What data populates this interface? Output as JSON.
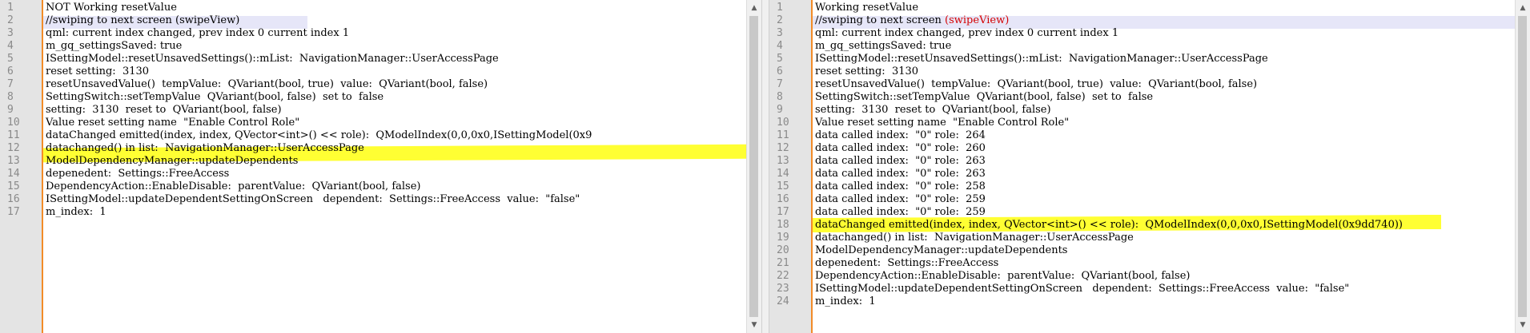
{
  "left_editor": {
    "lines": [
      {
        "n": "1",
        "text": "NOT Working resetValue"
      },
      {
        "n": "2",
        "text": "//swiping to next screen (swipeView)"
      },
      {
        "n": "3",
        "text": "qml: current index changed, prev index 0 current index 1"
      },
      {
        "n": "4",
        "text": "m_gq_settingsSaved: true"
      },
      {
        "n": "5",
        "text": "ISettingModel::resetUnsavedSettings()::mList:  NavigationManager::UserAccessPage"
      },
      {
        "n": "6",
        "text": "reset setting:  3130"
      },
      {
        "n": "7",
        "text": "resetUnsavedValue()  tempValue:  QVariant(bool, true)  value:  QVariant(bool, false)"
      },
      {
        "n": "8",
        "text": "SettingSwitch::setTempValue  QVariant(bool, false)  set to  false"
      },
      {
        "n": "9",
        "text": "setting:  3130  reset to  QVariant(bool, false)"
      },
      {
        "n": "10",
        "text": "Value reset setting name  \"Enable Control Role\""
      },
      {
        "n": "11",
        "text": "dataChanged emitted(index, index, QVector<int>() << role):  QModelIndex(0,0,0x0,ISettingModel(0x9"
      },
      {
        "n": "12",
        "text": "datachanged() in list:  NavigationManager::UserAccessPage"
      },
      {
        "n": "13",
        "text": "ModelDependencyManager::updateDependents"
      },
      {
        "n": "14",
        "text": "depenedent:  Settings::FreeAccess"
      },
      {
        "n": "15",
        "text": "DependencyAction::EnableDisable:  parentValue:  QVariant(bool, false)"
      },
      {
        "n": "16",
        "text": "ISettingModel::updateDependentSettingOnScreen   dependent:  Settings::FreeAccess  value:  \"false\""
      },
      {
        "n": "17",
        "text": "m_index:  1"
      }
    ]
  },
  "right_editor": {
    "lines": [
      {
        "n": "1",
        "text": "Working resetValue"
      },
      {
        "n": "2",
        "text": "//swiping to next screen ",
        "red": "(swipeView)"
      },
      {
        "n": "3",
        "text": "qml: current index changed, prev index 0 current index 1"
      },
      {
        "n": "4",
        "text": "m_gq_settingsSaved: true"
      },
      {
        "n": "5",
        "text": "ISettingModel::resetUnsavedSettings()::mList:  NavigationManager::UserAccessPage"
      },
      {
        "n": "6",
        "text": "reset setting:  3130"
      },
      {
        "n": "7",
        "text": "resetUnsavedValue()  tempValue:  QVariant(bool, true)  value:  QVariant(bool, false)"
      },
      {
        "n": "8",
        "text": "SettingSwitch::setTempValue  QVariant(bool, false)  set to  false"
      },
      {
        "n": "9",
        "text": "setting:  3130  reset to  QVariant(bool, false)"
      },
      {
        "n": "10",
        "text": "Value reset setting name  \"Enable Control Role\""
      },
      {
        "n": "11",
        "text": "data called index:  \"0\" role:  264"
      },
      {
        "n": "12",
        "text": "data called index:  \"0\" role:  260"
      },
      {
        "n": "13",
        "text": "data called index:  \"0\" role:  263"
      },
      {
        "n": "14",
        "text": "data called index:  \"0\" role:  263"
      },
      {
        "n": "15",
        "text": "data called index:  \"0\" role:  258"
      },
      {
        "n": "16",
        "text": "data called index:  \"0\" role:  259"
      },
      {
        "n": "17",
        "text": "data called index:  \"0\" role:  259"
      },
      {
        "n": "18",
        "text": "dataChanged emitted(index, index, QVector<int>() << role):  QModelIndex(0,0,0x0,ISettingModel(0x9dd740))"
      },
      {
        "n": "19",
        "text": "datachanged() in list:  NavigationManager::UserAccessPage"
      },
      {
        "n": "20",
        "text": "ModelDependencyManager::updateDependents"
      },
      {
        "n": "21",
        "text": "depenedent:  Settings::FreeAccess"
      },
      {
        "n": "22",
        "text": "DependencyAction::EnableDisable:  parentValue:  QVariant(bool, false)"
      },
      {
        "n": "23",
        "text": "ISettingModel::updateDependentSettingOnScreen   dependent:  Settings::FreeAccess  value:  \"false\""
      },
      {
        "n": "24",
        "text": "m_index:  1"
      }
    ]
  },
  "scroll": {
    "up_arrow": "▲",
    "down_arrow": "▼"
  },
  "colors": {
    "highlight": "#ffff33",
    "margin": "#f28c28",
    "selection": "#e6e6f8"
  }
}
